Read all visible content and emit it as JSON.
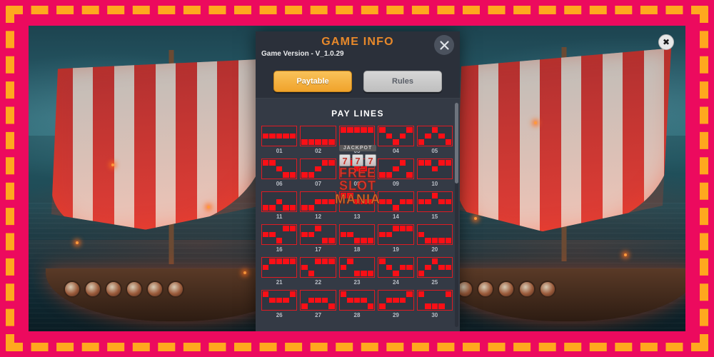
{
  "frame": {
    "border_color": "#ec0a5e",
    "dash_color": "#ffa81e"
  },
  "stage": {
    "close_badge_icon": "close-icon",
    "close_badge_glyph": "✖"
  },
  "modal": {
    "title": "GAME INFO",
    "version_label": "Game Version - V_1.0.29",
    "close_icon": "close-icon",
    "title_color": "#e8892a",
    "tabs": [
      {
        "label": "Paytable",
        "active": true,
        "color": "#f0a32b"
      },
      {
        "label": "Rules",
        "active": false,
        "color": "#c9c9c9"
      }
    ],
    "section_heading": "PAY LINES",
    "scrollbar": {
      "name": "vertical-scrollbar",
      "thumb_pct": 36
    }
  },
  "watermark": {
    "jackpot": "JACKPOT",
    "reels": [
      "7",
      "7",
      "7"
    ],
    "line1": "FREE",
    "line2": "SLOT",
    "line3": "MANIA"
  },
  "paylines": {
    "rows": 3,
    "cols": 5,
    "active_color": "#fa0f16",
    "border_color": "#e01b22",
    "items": [
      {
        "id": "01",
        "pattern": [
          1,
          1,
          1,
          1,
          1
        ]
      },
      {
        "id": "02",
        "pattern": [
          2,
          2,
          2,
          2,
          2
        ]
      },
      {
        "id": "03",
        "pattern": [
          0,
          0,
          0,
          0,
          0
        ]
      },
      {
        "id": "04",
        "pattern": [
          0,
          1,
          2,
          1,
          0
        ]
      },
      {
        "id": "05",
        "pattern": [
          2,
          1,
          0,
          1,
          2
        ]
      },
      {
        "id": "06",
        "pattern": [
          0,
          0,
          1,
          2,
          2
        ]
      },
      {
        "id": "07",
        "pattern": [
          2,
          2,
          1,
          0,
          0
        ]
      },
      {
        "id": "08",
        "pattern": [
          0,
          0,
          1,
          1,
          0
        ]
      },
      {
        "id": "09",
        "pattern": [
          2,
          2,
          1,
          0,
          2
        ]
      },
      {
        "id": "10",
        "pattern": [
          0,
          0,
          1,
          0,
          0
        ]
      },
      {
        "id": "11",
        "pattern": [
          2,
          2,
          1,
          2,
          2
        ]
      },
      {
        "id": "12",
        "pattern": [
          2,
          2,
          1,
          1,
          1
        ]
      },
      {
        "id": "13",
        "pattern": [
          0,
          0,
          1,
          1,
          1
        ]
      },
      {
        "id": "14",
        "pattern": [
          1,
          1,
          2,
          1,
          1
        ]
      },
      {
        "id": "15",
        "pattern": [
          1,
          1,
          0,
          1,
          1
        ]
      },
      {
        "id": "16",
        "pattern": [
          1,
          1,
          2,
          0,
          0
        ]
      },
      {
        "id": "17",
        "pattern": [
          1,
          1,
          0,
          2,
          2
        ]
      },
      {
        "id": "18",
        "pattern": [
          1,
          1,
          2,
          2,
          2
        ]
      },
      {
        "id": "19",
        "pattern": [
          1,
          1,
          0,
          0,
          0
        ]
      },
      {
        "id": "20",
        "pattern": [
          1,
          2,
          2,
          2,
          2
        ]
      },
      {
        "id": "21",
        "pattern": [
          1,
          0,
          0,
          0,
          0
        ]
      },
      {
        "id": "22",
        "pattern": [
          1,
          2,
          0,
          0,
          0
        ]
      },
      {
        "id": "23",
        "pattern": [
          1,
          0,
          2,
          2,
          2
        ]
      },
      {
        "id": "24",
        "pattern": [
          0,
          1,
          2,
          1,
          1
        ]
      },
      {
        "id": "25",
        "pattern": [
          2,
          1,
          0,
          1,
          1
        ]
      },
      {
        "id": "26",
        "pattern": [
          0,
          1,
          1,
          1,
          0
        ]
      },
      {
        "id": "27",
        "pattern": [
          2,
          1,
          1,
          1,
          2
        ]
      },
      {
        "id": "28",
        "pattern": [
          0,
          1,
          1,
          1,
          2
        ]
      },
      {
        "id": "29",
        "pattern": [
          2,
          1,
          1,
          1,
          0
        ]
      },
      {
        "id": "30",
        "pattern": [
          0,
          2,
          2,
          2,
          0
        ]
      }
    ]
  }
}
